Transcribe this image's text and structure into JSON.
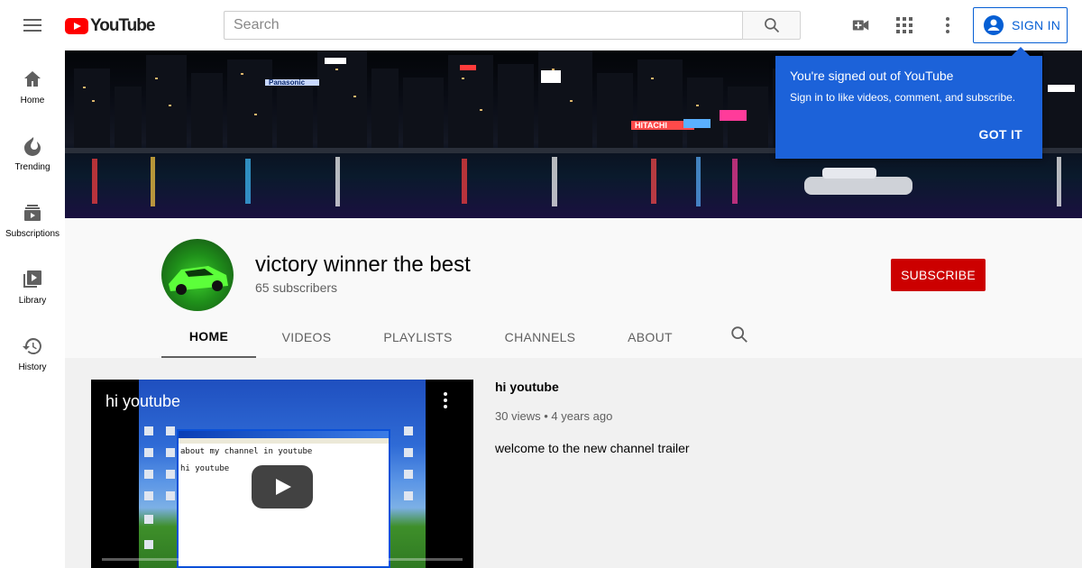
{
  "header": {
    "logo_text": "YouTube",
    "search_placeholder": "Search",
    "signin_label": "SIGN IN"
  },
  "sidebar": {
    "items": [
      {
        "label": "Home",
        "icon": "home-icon"
      },
      {
        "label": "Trending",
        "icon": "flame-icon"
      },
      {
        "label": "Subscriptions",
        "icon": "subscriptions-icon"
      },
      {
        "label": "Library",
        "icon": "library-icon"
      },
      {
        "label": "History",
        "icon": "history-icon"
      }
    ]
  },
  "banner": {
    "signs": [
      "Panasonic",
      "HITACHI"
    ]
  },
  "popup": {
    "title": "You're signed out of YouTube",
    "body": "Sign in to like videos, comment, and subscribe.",
    "button": "GOT IT"
  },
  "channel": {
    "name": "victory winner the best",
    "subscribers": "65 subscribers",
    "subscribe_label": "SUBSCRIBE",
    "tabs": [
      "HOME",
      "VIDEOS",
      "PLAYLISTS",
      "CHANNELS",
      "ABOUT"
    ],
    "active_tab": "HOME"
  },
  "featured_video": {
    "player_title": "hi youtube",
    "notepad_lines": [
      "about my channel in youtube",
      "hi youtube"
    ],
    "title": "hi youtube",
    "views": "30 views",
    "age": "4 years ago",
    "description": "welcome to the new channel trailer"
  },
  "colors": {
    "brand_red": "#ff0000",
    "subscribe_red": "#cc0000",
    "accent_blue": "#065fd4",
    "popup_blue": "#1c62d9"
  }
}
